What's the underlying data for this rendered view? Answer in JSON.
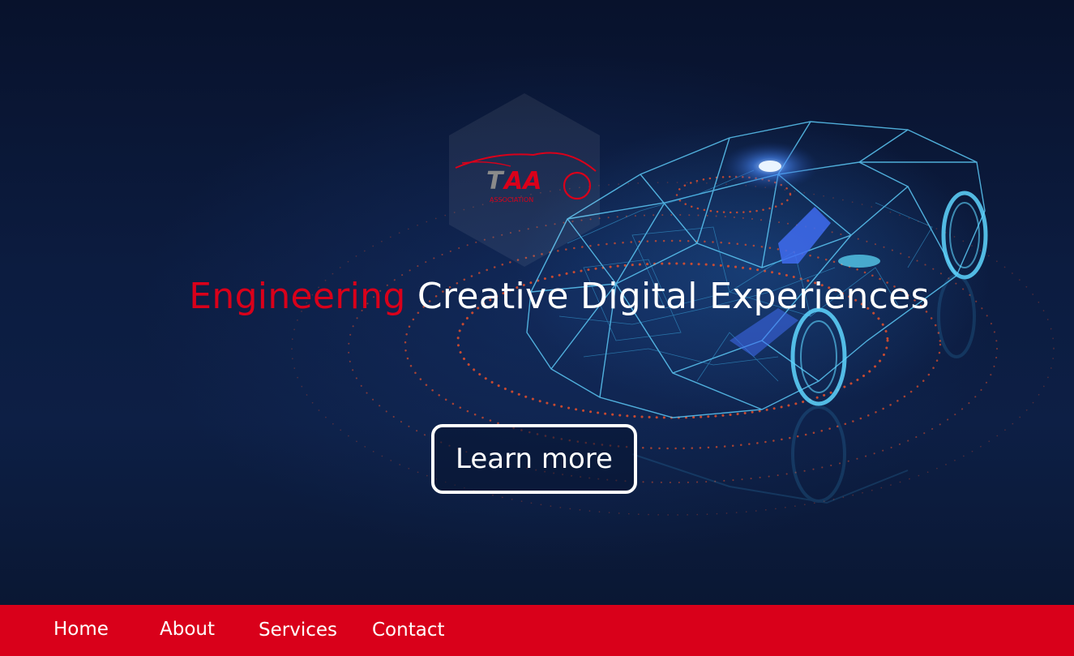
{
  "hero": {
    "headline_accent": "Engineering",
    "headline_rest": " Creative Digital Experiences",
    "cta_label": "Learn more",
    "background_image": "wireframe-car-illustration",
    "logo": {
      "name": "taa-logo",
      "text": "TAA",
      "subtext": "ASSOCIATION"
    }
  },
  "nav": {
    "items": [
      {
        "label": "Home"
      },
      {
        "label": "About"
      },
      {
        "label": "Services"
      },
      {
        "label": "Contact"
      }
    ]
  },
  "colors": {
    "brand_red": "#d9001a",
    "background_navy": "#0b1836",
    "text_white": "#ffffff",
    "wireframe_cyan": "#4fc3f7"
  }
}
